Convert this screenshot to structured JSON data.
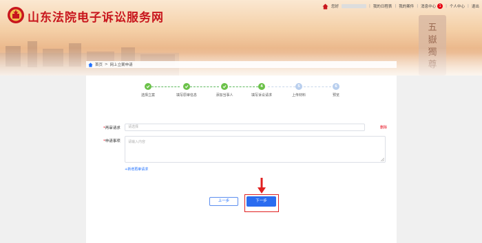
{
  "site": {
    "title": "山东法院电子诉讼服务网"
  },
  "topnav": {
    "greeting": "您好",
    "links": [
      "我的日程表",
      "我的案件",
      "消息中心",
      "个人中心",
      "退出"
    ],
    "message_count": "1",
    "separator": "|"
  },
  "breadcrumb": {
    "home": "首页",
    "separator": ">",
    "current": "网上立案申请"
  },
  "steps": [
    {
      "label": "选择立案",
      "status": "done"
    },
    {
      "label": "填写原审信息",
      "status": "done"
    },
    {
      "label": "添加当事人",
      "status": "done"
    },
    {
      "label": "填写诉讼请求",
      "status": "current",
      "number": "4"
    },
    {
      "label": "上传材料",
      "status": "todo",
      "number": "5"
    },
    {
      "label": "预览",
      "status": "todo",
      "number": "6"
    }
  ],
  "form": {
    "claim_label": "再审请求",
    "claim_placeholder": "请选择",
    "delete_label": "删除",
    "matter_label": "申请事项",
    "matter_placeholder": "请输入内容",
    "add_link": "+新增再审请求",
    "required_mark": "*"
  },
  "buttons": {
    "prev": "上一步",
    "next": "下一步"
  },
  "colors": {
    "brand_red": "#c8161d",
    "primary_blue": "#2a6cf0",
    "step_done": "#6cc24a",
    "step_todo": "#b9cfee",
    "highlight": "#e02020"
  }
}
